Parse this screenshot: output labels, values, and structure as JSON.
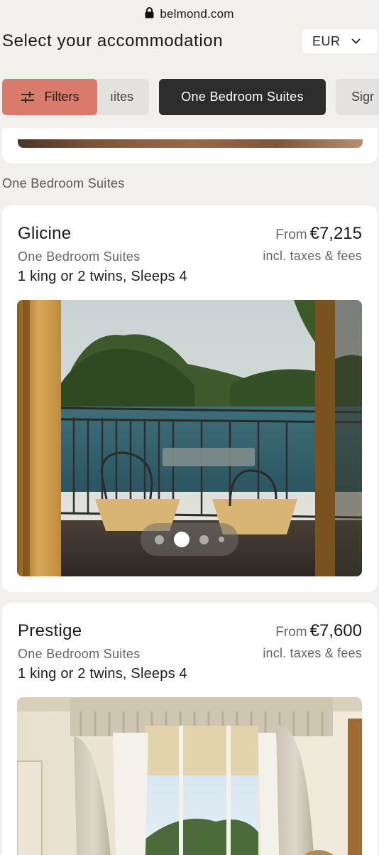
{
  "browser": {
    "url": "belmond.com"
  },
  "header": {
    "title": "Select your accommodation",
    "currency": "EUR"
  },
  "filters": {
    "filters_label": "Filters",
    "prev_chip": "ıites",
    "active_chip": "One Bedroom Suites",
    "next_chip": "Sigr"
  },
  "section": {
    "label": "One Bedroom Suites"
  },
  "rooms": [
    {
      "name": "Glicine",
      "category": "One Bedroom Suites",
      "beds": "1 king or 2 twins, Sleeps 4",
      "price_prefix": "From",
      "price": "€7,215",
      "taxes": "incl. taxes & fees",
      "carousel": {
        "total_dots": 4,
        "active_index": 1
      }
    },
    {
      "name": "Prestige",
      "category": "One Bedroom Suites",
      "beds": "1 king or 2 twins, Sleeps 4",
      "price_prefix": "From",
      "price": "€7,600",
      "taxes": "incl. taxes & fees"
    }
  ],
  "colors": {
    "background": "#f1f0ed",
    "filters_chip": "#d97a6c",
    "active_chip": "#2d2d2d",
    "card": "#ffffff"
  }
}
